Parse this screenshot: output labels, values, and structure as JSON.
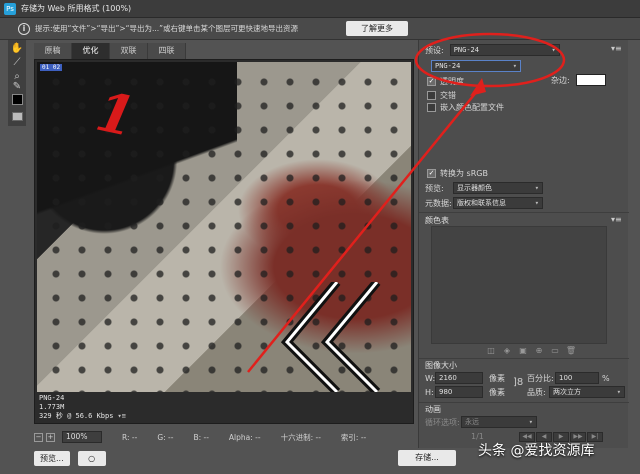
{
  "window": {
    "title": "存储为 Web 所用格式 (100%)",
    "app_icon_letter": "Ps"
  },
  "infobar": {
    "text": "提示:使用“文件”>“导出”>“导出为...”或右键单击某个图层可更快速地导出资源",
    "learn_more": "了解更多"
  },
  "tabs": [
    {
      "label": "原稿"
    },
    {
      "label": "优化"
    },
    {
      "label": "双联"
    },
    {
      "label": "四联"
    }
  ],
  "preview": {
    "tag": "01 02",
    "overlay_digit": "1",
    "format": "PNG-24",
    "size": "1.773M",
    "time": "329 秒 @ 56.6 Kbps",
    "menu_glyph": "▾≡"
  },
  "statusbar": {
    "zoom": "100%",
    "r": "R: --",
    "g": "G: --",
    "b": "B: --",
    "alpha": "Alpha: --",
    "hex": "十六进制: --",
    "index": "索引: --"
  },
  "footer": {
    "preview_button": "预览...",
    "browser_icon": "○",
    "save_button": "存储..."
  },
  "settings": {
    "preset_label": "预设:",
    "preset_value": "PNG-24",
    "format_value": "PNG-24",
    "transparency": "透明度",
    "interlaced": "交错",
    "embed_profile": "嵌入颜色配置文件",
    "matte_label": "杂边:",
    "convert_srgb": "转换为 sRGB",
    "preview_label": "预览:",
    "preview_value": "显示器颜色",
    "metadata_label": "元数据:",
    "metadata_value": "版权和联系信息",
    "color_table": "颜色表"
  },
  "image_size": {
    "title": "图像大小",
    "w_label": "W:",
    "w_value": "2160",
    "h_label": "H:",
    "h_value": "980",
    "unit": "像素",
    "percent_label": "百分比:",
    "percent_value": "100",
    "percent_unit": "%",
    "quality_label": "品质:",
    "quality_value": "两次立方"
  },
  "animation": {
    "title": "动画",
    "loop_label": "循环选项:",
    "loop_value": "永远",
    "frame": "1/1"
  },
  "watermark": {
    "text": "头条 @爱找资源库"
  },
  "colors": {
    "annotation": "#e0201c",
    "accent": "#3d5fbf"
  }
}
